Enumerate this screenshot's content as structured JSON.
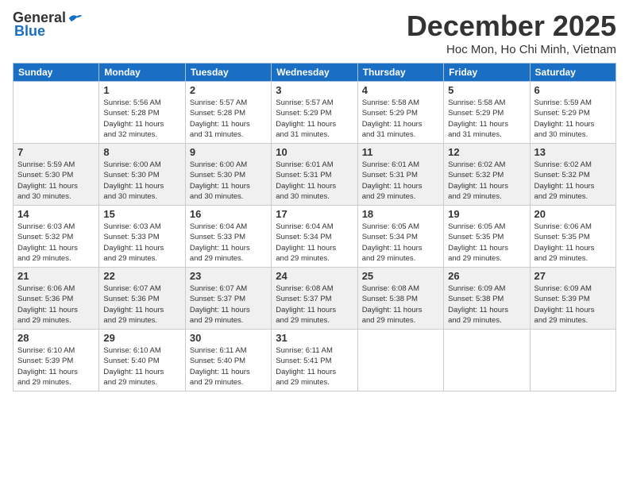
{
  "logo": {
    "general": "General",
    "blue": "Blue"
  },
  "header": {
    "title": "December 2025",
    "location": "Hoc Mon, Ho Chi Minh, Vietnam"
  },
  "weekdays": [
    "Sunday",
    "Monday",
    "Tuesday",
    "Wednesday",
    "Thursday",
    "Friday",
    "Saturday"
  ],
  "weeks": [
    [
      {
        "day": "",
        "info": ""
      },
      {
        "day": "1",
        "info": "Sunrise: 5:56 AM\nSunset: 5:28 PM\nDaylight: 11 hours\nand 32 minutes."
      },
      {
        "day": "2",
        "info": "Sunrise: 5:57 AM\nSunset: 5:28 PM\nDaylight: 11 hours\nand 31 minutes."
      },
      {
        "day": "3",
        "info": "Sunrise: 5:57 AM\nSunset: 5:29 PM\nDaylight: 11 hours\nand 31 minutes."
      },
      {
        "day": "4",
        "info": "Sunrise: 5:58 AM\nSunset: 5:29 PM\nDaylight: 11 hours\nand 31 minutes."
      },
      {
        "day": "5",
        "info": "Sunrise: 5:58 AM\nSunset: 5:29 PM\nDaylight: 11 hours\nand 31 minutes."
      },
      {
        "day": "6",
        "info": "Sunrise: 5:59 AM\nSunset: 5:29 PM\nDaylight: 11 hours\nand 30 minutes."
      }
    ],
    [
      {
        "day": "7",
        "info": "Sunrise: 5:59 AM\nSunset: 5:30 PM\nDaylight: 11 hours\nand 30 minutes."
      },
      {
        "day": "8",
        "info": "Sunrise: 6:00 AM\nSunset: 5:30 PM\nDaylight: 11 hours\nand 30 minutes."
      },
      {
        "day": "9",
        "info": "Sunrise: 6:00 AM\nSunset: 5:30 PM\nDaylight: 11 hours\nand 30 minutes."
      },
      {
        "day": "10",
        "info": "Sunrise: 6:01 AM\nSunset: 5:31 PM\nDaylight: 11 hours\nand 30 minutes."
      },
      {
        "day": "11",
        "info": "Sunrise: 6:01 AM\nSunset: 5:31 PM\nDaylight: 11 hours\nand 29 minutes."
      },
      {
        "day": "12",
        "info": "Sunrise: 6:02 AM\nSunset: 5:32 PM\nDaylight: 11 hours\nand 29 minutes."
      },
      {
        "day": "13",
        "info": "Sunrise: 6:02 AM\nSunset: 5:32 PM\nDaylight: 11 hours\nand 29 minutes."
      }
    ],
    [
      {
        "day": "14",
        "info": "Sunrise: 6:03 AM\nSunset: 5:32 PM\nDaylight: 11 hours\nand 29 minutes."
      },
      {
        "day": "15",
        "info": "Sunrise: 6:03 AM\nSunset: 5:33 PM\nDaylight: 11 hours\nand 29 minutes."
      },
      {
        "day": "16",
        "info": "Sunrise: 6:04 AM\nSunset: 5:33 PM\nDaylight: 11 hours\nand 29 minutes."
      },
      {
        "day": "17",
        "info": "Sunrise: 6:04 AM\nSunset: 5:34 PM\nDaylight: 11 hours\nand 29 minutes."
      },
      {
        "day": "18",
        "info": "Sunrise: 6:05 AM\nSunset: 5:34 PM\nDaylight: 11 hours\nand 29 minutes."
      },
      {
        "day": "19",
        "info": "Sunrise: 6:05 AM\nSunset: 5:35 PM\nDaylight: 11 hours\nand 29 minutes."
      },
      {
        "day": "20",
        "info": "Sunrise: 6:06 AM\nSunset: 5:35 PM\nDaylight: 11 hours\nand 29 minutes."
      }
    ],
    [
      {
        "day": "21",
        "info": "Sunrise: 6:06 AM\nSunset: 5:36 PM\nDaylight: 11 hours\nand 29 minutes."
      },
      {
        "day": "22",
        "info": "Sunrise: 6:07 AM\nSunset: 5:36 PM\nDaylight: 11 hours\nand 29 minutes."
      },
      {
        "day": "23",
        "info": "Sunrise: 6:07 AM\nSunset: 5:37 PM\nDaylight: 11 hours\nand 29 minutes."
      },
      {
        "day": "24",
        "info": "Sunrise: 6:08 AM\nSunset: 5:37 PM\nDaylight: 11 hours\nand 29 minutes."
      },
      {
        "day": "25",
        "info": "Sunrise: 6:08 AM\nSunset: 5:38 PM\nDaylight: 11 hours\nand 29 minutes."
      },
      {
        "day": "26",
        "info": "Sunrise: 6:09 AM\nSunset: 5:38 PM\nDaylight: 11 hours\nand 29 minutes."
      },
      {
        "day": "27",
        "info": "Sunrise: 6:09 AM\nSunset: 5:39 PM\nDaylight: 11 hours\nand 29 minutes."
      }
    ],
    [
      {
        "day": "28",
        "info": "Sunrise: 6:10 AM\nSunset: 5:39 PM\nDaylight: 11 hours\nand 29 minutes."
      },
      {
        "day": "29",
        "info": "Sunrise: 6:10 AM\nSunset: 5:40 PM\nDaylight: 11 hours\nand 29 minutes."
      },
      {
        "day": "30",
        "info": "Sunrise: 6:11 AM\nSunset: 5:40 PM\nDaylight: 11 hours\nand 29 minutes."
      },
      {
        "day": "31",
        "info": "Sunrise: 6:11 AM\nSunset: 5:41 PM\nDaylight: 11 hours\nand 29 minutes."
      },
      {
        "day": "",
        "info": ""
      },
      {
        "day": "",
        "info": ""
      },
      {
        "day": "",
        "info": ""
      }
    ]
  ]
}
